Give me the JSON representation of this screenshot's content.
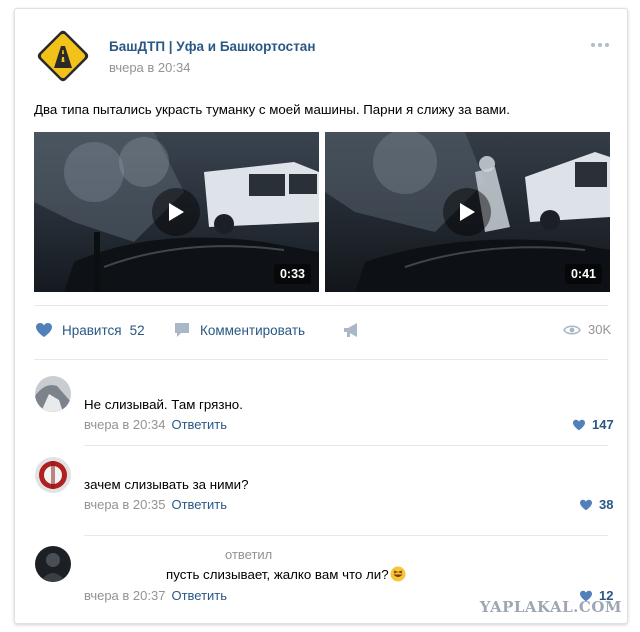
{
  "post": {
    "group_name": "БашДТП | Уфа и Башкортостан",
    "date": "вчера в 20:34",
    "text": "Два типа пытались украсть туманку с моей машины. Парни я слижу за вами.",
    "avatar_icon": "road-warning-sign-icon",
    "menu_icon": "more-dots-icon",
    "videos": [
      {
        "duration": "0:33"
      },
      {
        "duration": "0:41"
      }
    ]
  },
  "actions": {
    "like_label": "Нравится",
    "like_count": "52",
    "comment_label": "Комментировать",
    "share_icon": "megaphone-icon",
    "views_count": "30K",
    "views_icon": "eye-icon"
  },
  "comments": [
    {
      "text": "Не слизывай. Там грязно.",
      "date": "вчера в 20:34",
      "reply_label": "Ответить",
      "likes": "147"
    },
    {
      "text": "зачем слизывать за ними?",
      "date": "вчера в 20:35",
      "reply_label": "Ответить",
      "likes": "38"
    },
    {
      "answered_label": "ответил",
      "text": "пусть слизывает, жалко вам что ли?",
      "date": "вчера в 20:37",
      "reply_label": "Ответить",
      "likes": "12"
    }
  ],
  "colors": {
    "link": "#2a5885",
    "meta": "#939393",
    "accent_sign": "#f2c21b"
  },
  "watermark": "YAPLAKAL.COM"
}
